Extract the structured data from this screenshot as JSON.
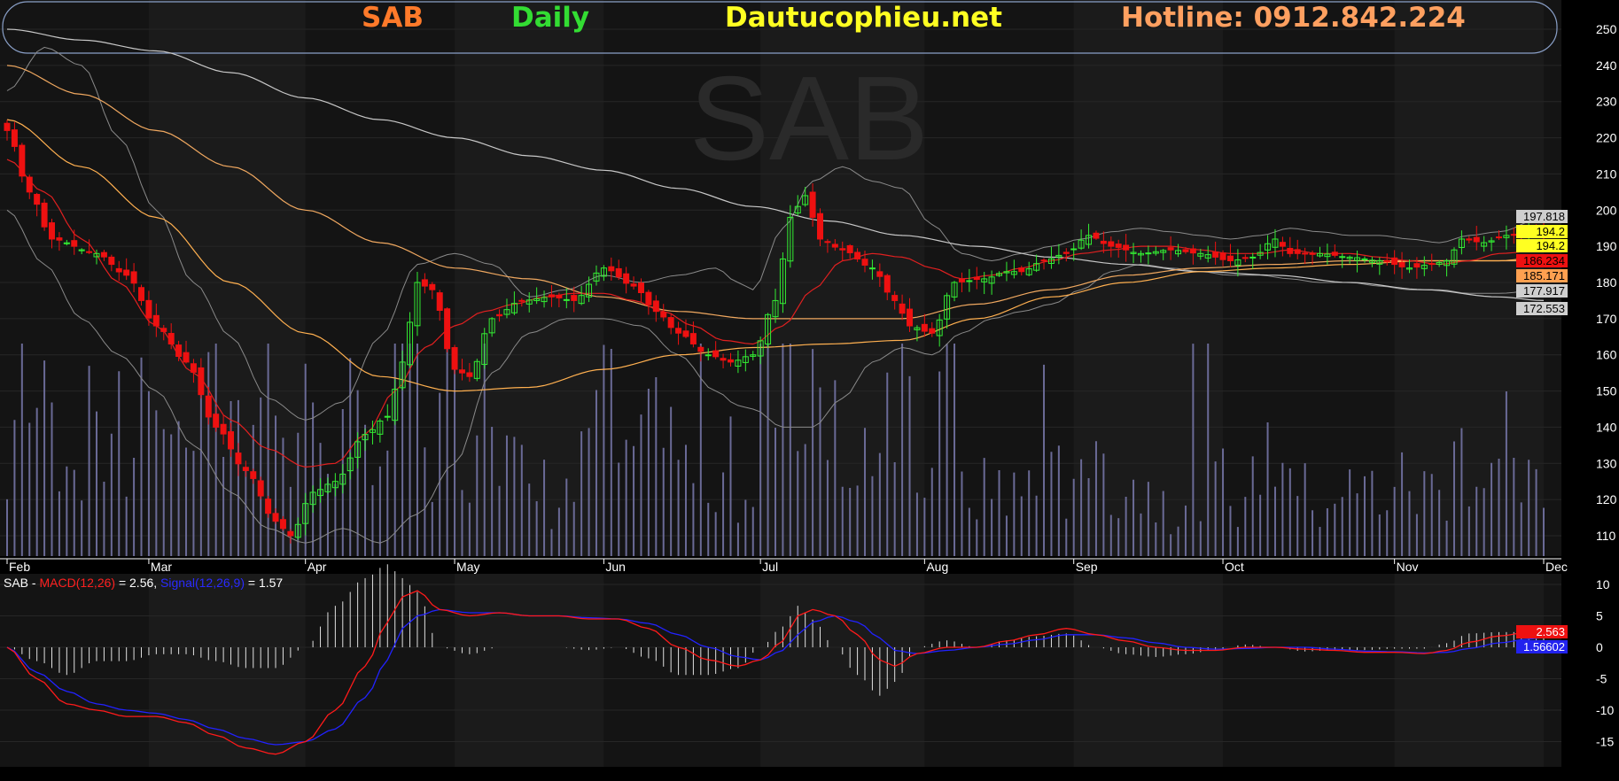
{
  "header": {
    "symbol": "SAB",
    "timeframe": "Daily",
    "site": "Dautucophieu.net",
    "hotline": "Hotline: 0912.842.224"
  },
  "watermark": "SAB",
  "colors": {
    "background": "#000000",
    "panel": "#151515",
    "up": "#33ee33",
    "down": "#ee1111",
    "ma20": "#e02020",
    "ma50": "#ffb050",
    "ma100": "#f0a860",
    "ma200": "#c8c8c8",
    "bollinger": "#8a8a8a",
    "volume": "#6a6a96",
    "macd": "#ff1a1a",
    "signal": "#2222ff",
    "histogram": "#e0e0e0",
    "symbol_text": "#ff7a2a",
    "timeframe_text": "#33dd33",
    "site_text": "#ffff22",
    "hotline_text": "#ffa060"
  },
  "price_axis": {
    "ticks": [
      250,
      240,
      230,
      220,
      210,
      200,
      190,
      180,
      170,
      160,
      150,
      140,
      130,
      120,
      110
    ],
    "ylim": [
      106,
      254
    ]
  },
  "x_axis": {
    "months": [
      {
        "label": "Feb",
        "day": 0
      },
      {
        "label": "Mar",
        "day": 19
      },
      {
        "label": "Apr",
        "day": 40
      },
      {
        "label": "May",
        "day": 60
      },
      {
        "label": "Jun",
        "day": 80
      },
      {
        "label": "Jul",
        "day": 101
      },
      {
        "label": "Aug",
        "day": 123
      },
      {
        "label": "Sep",
        "day": 143
      },
      {
        "label": "Oct",
        "day": 163
      },
      {
        "label": "Nov",
        "day": 186
      },
      {
        "label": "Dec",
        "day": 206
      }
    ],
    "days": 207
  },
  "price_badges": [
    {
      "value": "197.818",
      "bg": "#cfcfcf",
      "fg": "#000000"
    },
    {
      "value": "194.2",
      "bg": "#ffff22",
      "fg": "#000000"
    },
    {
      "value": "194.2",
      "bg": "#ffff22",
      "fg": "#000000"
    },
    {
      "value": "186.234",
      "bg": "#ee1111",
      "fg": "#000000"
    },
    {
      "value": "185.171",
      "bg": "#ffa050",
      "fg": "#000000"
    },
    {
      "value": "177.917",
      "bg": "#cfcfcf",
      "fg": "#000000"
    },
    {
      "value": "172.553",
      "bg": "#cfcfcf",
      "fg": "#000000"
    }
  ],
  "macd_legend": {
    "symbol": "SAB",
    "sep": " - ",
    "macd_name": "MACD(12,26)",
    "macd_eq": " = 2.56, ",
    "signal_name": "Signal(12,26,9)",
    "signal_eq": " = 1.57"
  },
  "macd_axis": {
    "ticks": [
      10,
      5,
      0,
      -5,
      -10,
      -15
    ],
    "ylim": [
      -18,
      12
    ]
  },
  "macd_badges": [
    {
      "value": "2.563",
      "bg": "#ee1111",
      "fg": "#ffffff"
    },
    {
      "value": "1.56602",
      "bg": "#2222ee",
      "fg": "#ffffff"
    }
  ],
  "chart_data": {
    "type": "candlestick",
    "price_anchors": [
      [
        0,
        222
      ],
      [
        3,
        205
      ],
      [
        6,
        192
      ],
      [
        12,
        188
      ],
      [
        16,
        182
      ],
      [
        20,
        168
      ],
      [
        24,
        158
      ],
      [
        28,
        140
      ],
      [
        32,
        128
      ],
      [
        36,
        114
      ],
      [
        38,
        110
      ],
      [
        41,
        122
      ],
      [
        44,
        125
      ],
      [
        48,
        138
      ],
      [
        51,
        143
      ],
      [
        53,
        158
      ],
      [
        55,
        180
      ],
      [
        57,
        178
      ],
      [
        60,
        156
      ],
      [
        62,
        154
      ],
      [
        65,
        170
      ],
      [
        69,
        175
      ],
      [
        73,
        176
      ],
      [
        76,
        175
      ],
      [
        80,
        184
      ],
      [
        84,
        179
      ],
      [
        87,
        172
      ],
      [
        90,
        166
      ],
      [
        94,
        160
      ],
      [
        97,
        158
      ],
      [
        100,
        160
      ],
      [
        103,
        175
      ],
      [
        105,
        198
      ],
      [
        107,
        204
      ],
      [
        109,
        192
      ],
      [
        112,
        189
      ],
      [
        116,
        184
      ],
      [
        119,
        175
      ],
      [
        121,
        168
      ],
      [
        124,
        166
      ],
      [
        127,
        180
      ],
      [
        131,
        181
      ],
      [
        134,
        183
      ],
      [
        136,
        183
      ],
      [
        139,
        186
      ],
      [
        142,
        188
      ],
      [
        145,
        193
      ],
      [
        148,
        190
      ],
      [
        152,
        188
      ],
      [
        156,
        189
      ],
      [
        160,
        188
      ],
      [
        164,
        186
      ],
      [
        167,
        187
      ],
      [
        170,
        192
      ],
      [
        172,
        188
      ],
      [
        176,
        188
      ],
      [
        180,
        187
      ],
      [
        184,
        186
      ],
      [
        188,
        184
      ],
      [
        191,
        185
      ],
      [
        193,
        186
      ],
      [
        195,
        192
      ],
      [
        198,
        191
      ],
      [
        201,
        193
      ],
      [
        204,
        194
      ],
      [
        206,
        194
      ]
    ],
    "ma20_anchors": [
      [
        0,
        214
      ],
      [
        5,
        205
      ],
      [
        10,
        192
      ],
      [
        15,
        180
      ],
      [
        20,
        168
      ],
      [
        25,
        155
      ],
      [
        30,
        142
      ],
      [
        35,
        134
      ],
      [
        40,
        129
      ],
      [
        44,
        130
      ],
      [
        48,
        138
      ],
      [
        52,
        150
      ],
      [
        56,
        162
      ],
      [
        60,
        168
      ],
      [
        64,
        172
      ],
      [
        68,
        174
      ],
      [
        72,
        176
      ],
      [
        76,
        177
      ],
      [
        80,
        177
      ],
      [
        84,
        175
      ],
      [
        88,
        172
      ],
      [
        92,
        168
      ],
      [
        96,
        164
      ],
      [
        100,
        163
      ],
      [
        104,
        168
      ],
      [
        108,
        178
      ],
      [
        112,
        186
      ],
      [
        116,
        188
      ],
      [
        120,
        187
      ],
      [
        124,
        184
      ],
      [
        128,
        181
      ],
      [
        132,
        182
      ],
      [
        136,
        184
      ],
      [
        140,
        186
      ],
      [
        144,
        188
      ],
      [
        148,
        189
      ],
      [
        152,
        190
      ],
      [
        156,
        190
      ],
      [
        160,
        189
      ],
      [
        164,
        188
      ],
      [
        168,
        188
      ],
      [
        172,
        189
      ],
      [
        176,
        188
      ],
      [
        180,
        188
      ],
      [
        184,
        187
      ],
      [
        188,
        186
      ],
      [
        192,
        185
      ],
      [
        196,
        186
      ],
      [
        200,
        188
      ],
      [
        206,
        189
      ]
    ],
    "ma50_anchors": [
      [
        0,
        225
      ],
      [
        10,
        212
      ],
      [
        20,
        198
      ],
      [
        30,
        180
      ],
      [
        40,
        166
      ],
      [
        50,
        154
      ],
      [
        60,
        150
      ],
      [
        70,
        151
      ],
      [
        80,
        156
      ],
      [
        90,
        160
      ],
      [
        100,
        162
      ],
      [
        110,
        163
      ],
      [
        120,
        164
      ],
      [
        130,
        170
      ],
      [
        140,
        176
      ],
      [
        150,
        180
      ],
      [
        160,
        183
      ],
      [
        170,
        184
      ],
      [
        180,
        185
      ],
      [
        190,
        186
      ],
      [
        200,
        186
      ],
      [
        206,
        187
      ]
    ],
    "ma100_anchors": [
      [
        0,
        240
      ],
      [
        10,
        232
      ],
      [
        20,
        222
      ],
      [
        30,
        212
      ],
      [
        40,
        200
      ],
      [
        50,
        191
      ],
      [
        60,
        184
      ],
      [
        70,
        181
      ],
      [
        80,
        176
      ],
      [
        90,
        172
      ],
      [
        100,
        170
      ],
      [
        110,
        170
      ],
      [
        120,
        170
      ],
      [
        130,
        174
      ],
      [
        140,
        178
      ],
      [
        150,
        182
      ],
      [
        160,
        184
      ],
      [
        170,
        185
      ],
      [
        180,
        186
      ],
      [
        190,
        186
      ],
      [
        200,
        186
      ],
      [
        206,
        186
      ]
    ],
    "ma200_anchors": [
      [
        0,
        250
      ],
      [
        10,
        247
      ],
      [
        20,
        244
      ],
      [
        30,
        238
      ],
      [
        40,
        231
      ],
      [
        50,
        225
      ],
      [
        60,
        220
      ],
      [
        70,
        215
      ],
      [
        80,
        211
      ],
      [
        90,
        206
      ],
      [
        100,
        201
      ],
      [
        110,
        197
      ],
      [
        120,
        193
      ],
      [
        130,
        190
      ],
      [
        140,
        187
      ],
      [
        150,
        185
      ],
      [
        160,
        183
      ],
      [
        170,
        182
      ],
      [
        180,
        180
      ],
      [
        190,
        178
      ],
      [
        200,
        176
      ],
      [
        206,
        175
      ]
    ],
    "bb_upper_anchors": [
      [
        0,
        233
      ],
      [
        5,
        245
      ],
      [
        10,
        240
      ],
      [
        15,
        220
      ],
      [
        20,
        200
      ],
      [
        25,
        180
      ],
      [
        30,
        165
      ],
      [
        35,
        148
      ],
      [
        40,
        142
      ],
      [
        45,
        147
      ],
      [
        50,
        165
      ],
      [
        55,
        185
      ],
      [
        60,
        188
      ],
      [
        65,
        185
      ],
      [
        70,
        176
      ],
      [
        75,
        178
      ],
      [
        80,
        182
      ],
      [
        85,
        180
      ],
      [
        90,
        182
      ],
      [
        95,
        184
      ],
      [
        98,
        180
      ],
      [
        100,
        178
      ],
      [
        104,
        195
      ],
      [
        108,
        208
      ],
      [
        112,
        212
      ],
      [
        116,
        208
      ],
      [
        120,
        206
      ],
      [
        124,
        196
      ],
      [
        128,
        188
      ],
      [
        132,
        186
      ],
      [
        136,
        188
      ],
      [
        140,
        190
      ],
      [
        144,
        192
      ],
      [
        148,
        194
      ],
      [
        152,
        195
      ],
      [
        156,
        194
      ],
      [
        160,
        193
      ],
      [
        164,
        192
      ],
      [
        168,
        193
      ],
      [
        172,
        195
      ],
      [
        176,
        194
      ],
      [
        180,
        193
      ],
      [
        184,
        193
      ],
      [
        188,
        192
      ],
      [
        192,
        191
      ],
      [
        196,
        193
      ],
      [
        200,
        194
      ],
      [
        206,
        198
      ]
    ],
    "bb_lower_anchors": [
      [
        0,
        200
      ],
      [
        5,
        185
      ],
      [
        10,
        170
      ],
      [
        15,
        160
      ],
      [
        20,
        150
      ],
      [
        25,
        135
      ],
      [
        30,
        122
      ],
      [
        35,
        112
      ],
      [
        40,
        108
      ],
      [
        45,
        112
      ],
      [
        50,
        108
      ],
      [
        55,
        116
      ],
      [
        60,
        130
      ],
      [
        65,
        155
      ],
      [
        70,
        166
      ],
      [
        75,
        170
      ],
      [
        80,
        170
      ],
      [
        85,
        168
      ],
      [
        90,
        160
      ],
      [
        95,
        150
      ],
      [
        98,
        146
      ],
      [
        100,
        145
      ],
      [
        104,
        140
      ],
      [
        108,
        140
      ],
      [
        112,
        148
      ],
      [
        116,
        158
      ],
      [
        120,
        162
      ],
      [
        124,
        160
      ],
      [
        128,
        166
      ],
      [
        132,
        170
      ],
      [
        136,
        172
      ],
      [
        140,
        174
      ],
      [
        144,
        178
      ],
      [
        148,
        183
      ],
      [
        152,
        185
      ],
      [
        156,
        184
      ],
      [
        160,
        183
      ],
      [
        164,
        182
      ],
      [
        168,
        182
      ],
      [
        172,
        181
      ],
      [
        176,
        180
      ],
      [
        180,
        180
      ],
      [
        184,
        179
      ],
      [
        188,
        178
      ],
      [
        192,
        178
      ],
      [
        196,
        177
      ],
      [
        200,
        177
      ],
      [
        206,
        178
      ]
    ],
    "volume_seed": 7,
    "macd_anchors": [
      [
        0,
        0
      ],
      [
        4,
        -5
      ],
      [
        8,
        -9
      ],
      [
        12,
        -10
      ],
      [
        16,
        -11
      ],
      [
        20,
        -11
      ],
      [
        24,
        -12
      ],
      [
        28,
        -14
      ],
      [
        32,
        -16
      ],
      [
        36,
        -17
      ],
      [
        40,
        -15
      ],
      [
        44,
        -10
      ],
      [
        48,
        -3
      ],
      [
        51,
        4
      ],
      [
        53,
        8
      ],
      [
        55,
        9
      ],
      [
        58,
        6
      ],
      [
        62,
        5
      ],
      [
        66,
        5.5
      ],
      [
        70,
        5
      ],
      [
        74,
        5
      ],
      [
        78,
        4.5
      ],
      [
        82,
        4.5
      ],
      [
        86,
        3
      ],
      [
        90,
        0
      ],
      [
        94,
        -2
      ],
      [
        98,
        -3
      ],
      [
        101,
        -2
      ],
      [
        104,
        1
      ],
      [
        106,
        5
      ],
      [
        108,
        6
      ],
      [
        111,
        5
      ],
      [
        114,
        2
      ],
      [
        117,
        -2
      ],
      [
        119,
        -3
      ],
      [
        122,
        -1
      ],
      [
        126,
        0
      ],
      [
        130,
        0
      ],
      [
        134,
        1
      ],
      [
        138,
        2
      ],
      [
        142,
        3
      ],
      [
        146,
        2
      ],
      [
        150,
        1
      ],
      [
        154,
        0
      ],
      [
        158,
        -0.5
      ],
      [
        162,
        -0.5
      ],
      [
        166,
        0
      ],
      [
        170,
        0
      ],
      [
        174,
        -0.3
      ],
      [
        178,
        -0.5
      ],
      [
        182,
        -0.8
      ],
      [
        186,
        -0.8
      ],
      [
        190,
        -1
      ],
      [
        193,
        -0.5
      ],
      [
        196,
        0.8
      ],
      [
        200,
        1.8
      ],
      [
        204,
        2.4
      ],
      [
        206,
        2.56
      ]
    ],
    "signal_anchors": [
      [
        0,
        0
      ],
      [
        4,
        -4
      ],
      [
        8,
        -7
      ],
      [
        12,
        -9
      ],
      [
        16,
        -10
      ],
      [
        20,
        -10.5
      ],
      [
        24,
        -11.5
      ],
      [
        28,
        -13
      ],
      [
        32,
        -14.5
      ],
      [
        36,
        -15.5
      ],
      [
        40,
        -15
      ],
      [
        44,
        -13
      ],
      [
        48,
        -8
      ],
      [
        51,
        -2
      ],
      [
        53,
        3
      ],
      [
        55,
        5
      ],
      [
        58,
        6
      ],
      [
        62,
        5.5
      ],
      [
        66,
        5.5
      ],
      [
        70,
        5
      ],
      [
        74,
        5
      ],
      [
        78,
        4.7
      ],
      [
        82,
        4.5
      ],
      [
        86,
        3.8
      ],
      [
        90,
        2
      ],
      [
        94,
        0
      ],
      [
        98,
        -1.5
      ],
      [
        101,
        -2
      ],
      [
        104,
        -0.5
      ],
      [
        106,
        2
      ],
      [
        108,
        4
      ],
      [
        111,
        5
      ],
      [
        114,
        4
      ],
      [
        117,
        1.5
      ],
      [
        119,
        -0.5
      ],
      [
        122,
        -1
      ],
      [
        126,
        -0.5
      ],
      [
        130,
        0
      ],
      [
        134,
        0.5
      ],
      [
        138,
        1.2
      ],
      [
        142,
        2
      ],
      [
        146,
        2
      ],
      [
        150,
        1.5
      ],
      [
        154,
        0.7
      ],
      [
        158,
        0
      ],
      [
        162,
        -0.3
      ],
      [
        166,
        -0.2
      ],
      [
        170,
        0
      ],
      [
        174,
        0
      ],
      [
        178,
        -0.3
      ],
      [
        182,
        -0.6
      ],
      [
        186,
        -0.7
      ],
      [
        190,
        -0.9
      ],
      [
        193,
        -0.8
      ],
      [
        196,
        -0.2
      ],
      [
        200,
        0.7
      ],
      [
        204,
        1.3
      ],
      [
        206,
        1.57
      ]
    ]
  }
}
